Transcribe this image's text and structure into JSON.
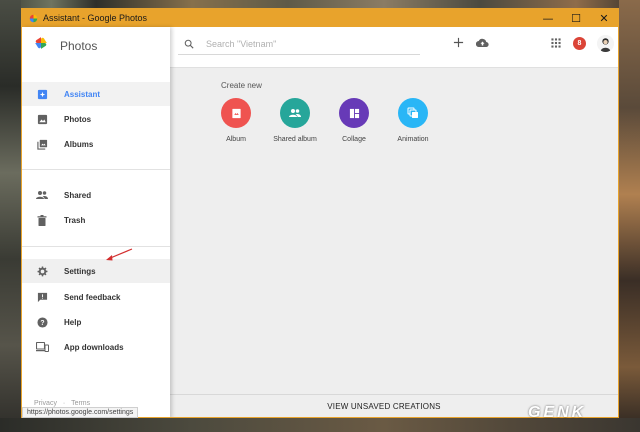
{
  "window": {
    "title": "Assistant - Google Photos",
    "controls": {
      "minimize": "—",
      "maximize": "☐",
      "close": "✕"
    },
    "accent_color": "#e8a32c"
  },
  "sidebar": {
    "brand": "Photos",
    "items": [
      {
        "label": "Assistant",
        "icon": "assistant-icon",
        "active": true
      },
      {
        "label": "Photos",
        "icon": "photo-icon"
      },
      {
        "label": "Albums",
        "icon": "albums-icon"
      },
      {
        "label": "Shared",
        "icon": "people-icon"
      },
      {
        "label": "Trash",
        "icon": "trash-icon"
      },
      {
        "label": "Settings",
        "icon": "gear-icon"
      },
      {
        "label": "Send feedback",
        "icon": "feedback-icon"
      },
      {
        "label": "Help",
        "icon": "help-icon"
      },
      {
        "label": "App downloads",
        "icon": "devices-icon"
      }
    ],
    "footer": {
      "privacy": "Privacy",
      "separator": "·",
      "terms": "Terms"
    }
  },
  "header": {
    "search_placeholder": "Search \"Vietnam\"",
    "notification_count": "8"
  },
  "main": {
    "create_new_label": "Create new",
    "create_options": [
      {
        "label": "Album",
        "icon": "album-icon",
        "color": "#ef5350"
      },
      {
        "label": "Shared album",
        "icon": "shared-album-icon",
        "color": "#26a69a"
      },
      {
        "label": "Collage",
        "icon": "collage-icon",
        "color": "#673ab7"
      },
      {
        "label": "Animation",
        "icon": "animation-icon",
        "color": "#29b6f6"
      }
    ],
    "bottom_bar_label": "VIEW UNSAVED CREATIONS"
  },
  "status_url": "https://photos.google.com/settings",
  "watermark": "GENK"
}
